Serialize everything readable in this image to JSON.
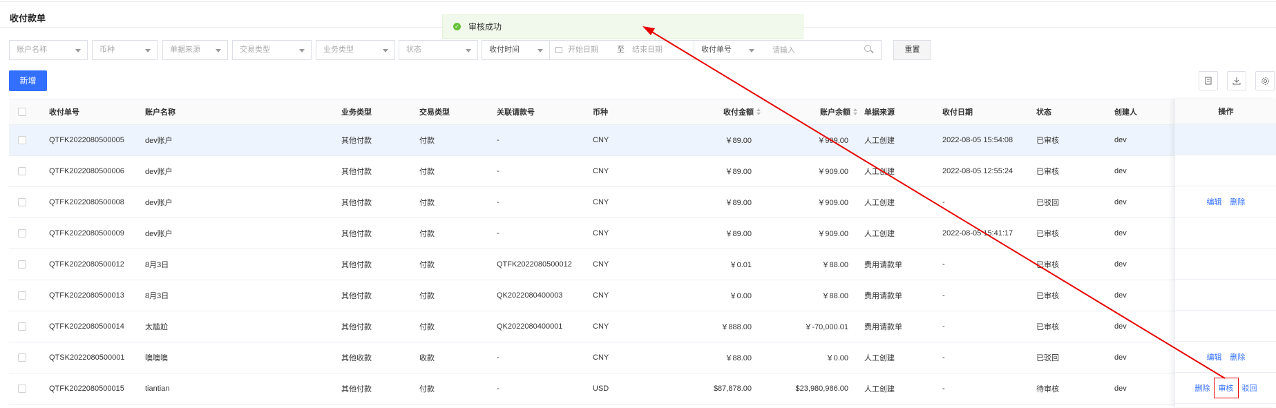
{
  "page_title": "收付款单",
  "toast": {
    "message": "审核成功"
  },
  "filters": {
    "account_name": "账户名称",
    "currency": "币种",
    "doc_source": "单据来源",
    "trade_type": "交易类型",
    "business_type": "业务类型",
    "status": "状态",
    "time_type": "收付时间",
    "start_date": "开始日期",
    "date_sep": "至",
    "end_date": "结束日期",
    "search_field": "收付单号",
    "search_placeholder": "请输入",
    "reset_label": "重置"
  },
  "toolbar": {
    "add_label": "新增"
  },
  "table": {
    "columns": [
      "收付单号",
      "账户名称",
      "业务类型",
      "交易类型",
      "关联请款号",
      "币种",
      "收付金额",
      "账户余额",
      "单据来源",
      "收付日期",
      "状态",
      "创建人",
      "操作"
    ],
    "rows": [
      {
        "no": "QTFK2022080500005",
        "account": "dev账户",
        "biz": "其他付款",
        "trade": "付款",
        "ref": "-",
        "cur": "CNY",
        "amount": "￥89.00",
        "balance": "￥909.00",
        "source": "人工创建",
        "date": "2022-08-05 15:54:08",
        "status": "已审核",
        "creator": "dev",
        "ops": []
      },
      {
        "no": "QTFK2022080500006",
        "account": "dev账户",
        "biz": "其他付款",
        "trade": "付款",
        "ref": "-",
        "cur": "CNY",
        "amount": "￥89.00",
        "balance": "￥909.00",
        "source": "人工创建",
        "date": "2022-08-05 12:55:24",
        "status": "已审核",
        "creator": "dev",
        "ops": []
      },
      {
        "no": "QTFK2022080500008",
        "account": "dev账户",
        "biz": "其他付款",
        "trade": "付款",
        "ref": "-",
        "cur": "CNY",
        "amount": "￥89.00",
        "balance": "￥909.00",
        "source": "人工创建",
        "date": "-",
        "status": "已驳回",
        "creator": "dev",
        "ops": [
          "编辑",
          "删除"
        ]
      },
      {
        "no": "QTFK2022080500009",
        "account": "dev账户",
        "biz": "其他付款",
        "trade": "付款",
        "ref": "-",
        "cur": "CNY",
        "amount": "￥89.00",
        "balance": "￥909.00",
        "source": "人工创建",
        "date": "2022-08-05 15:41:17",
        "status": "已审核",
        "creator": "dev",
        "ops": []
      },
      {
        "no": "QTFK2022080500012",
        "account": "8月3日",
        "biz": "其他付款",
        "trade": "付款",
        "ref": "QTFK2022080500012",
        "cur": "CNY",
        "amount": "￥0.01",
        "balance": "￥88.00",
        "source": "费用请款单",
        "date": "-",
        "status": "已审核",
        "creator": "dev",
        "ops": []
      },
      {
        "no": "QTFK2022080500013",
        "account": "8月3日",
        "biz": "其他付款",
        "trade": "付款",
        "ref": "QK2022080400003",
        "cur": "CNY",
        "amount": "￥0.00",
        "balance": "￥88.00",
        "source": "费用请款单",
        "date": "-",
        "status": "已审核",
        "creator": "dev",
        "ops": []
      },
      {
        "no": "QTFK2022080500014",
        "account": "太尴尬",
        "biz": "其他付款",
        "trade": "付款",
        "ref": "QK2022080400001",
        "cur": "CNY",
        "amount": "￥888.00",
        "balance": "￥-70,000.01",
        "source": "费用请款单",
        "date": "-",
        "status": "已审核",
        "creator": "dev",
        "ops": []
      },
      {
        "no": "QTSK2022080500001",
        "account": "噢噢噢",
        "biz": "其他收款",
        "trade": "收款",
        "ref": "-",
        "cur": "CNY",
        "amount": "￥88.00",
        "balance": "￥0.00",
        "source": "人工创建",
        "date": "-",
        "status": "已驳回",
        "creator": "dev",
        "ops": [
          "编辑",
          "删除"
        ]
      },
      {
        "no": "QTFK2022080500015",
        "account": "tiantian",
        "biz": "其他付款",
        "trade": "付款",
        "ref": "-",
        "cur": "USD",
        "amount": "$87,878.00",
        "balance": "$23,980,986.00",
        "source": "人工创建",
        "date": "-",
        "status": "待审核",
        "creator": "dev",
        "ops": [
          "删除",
          "审核",
          "驳回"
        ]
      }
    ]
  },
  "colors": {
    "primary": "#3370ff",
    "success": "#67c23a",
    "annotation": "#e60000",
    "row_highlight": "#eef4fd"
  },
  "icons": [
    "check-circle-icon",
    "calendar-icon",
    "search-icon",
    "print-icon",
    "download-icon",
    "settings-icon",
    "sort-icon"
  ]
}
